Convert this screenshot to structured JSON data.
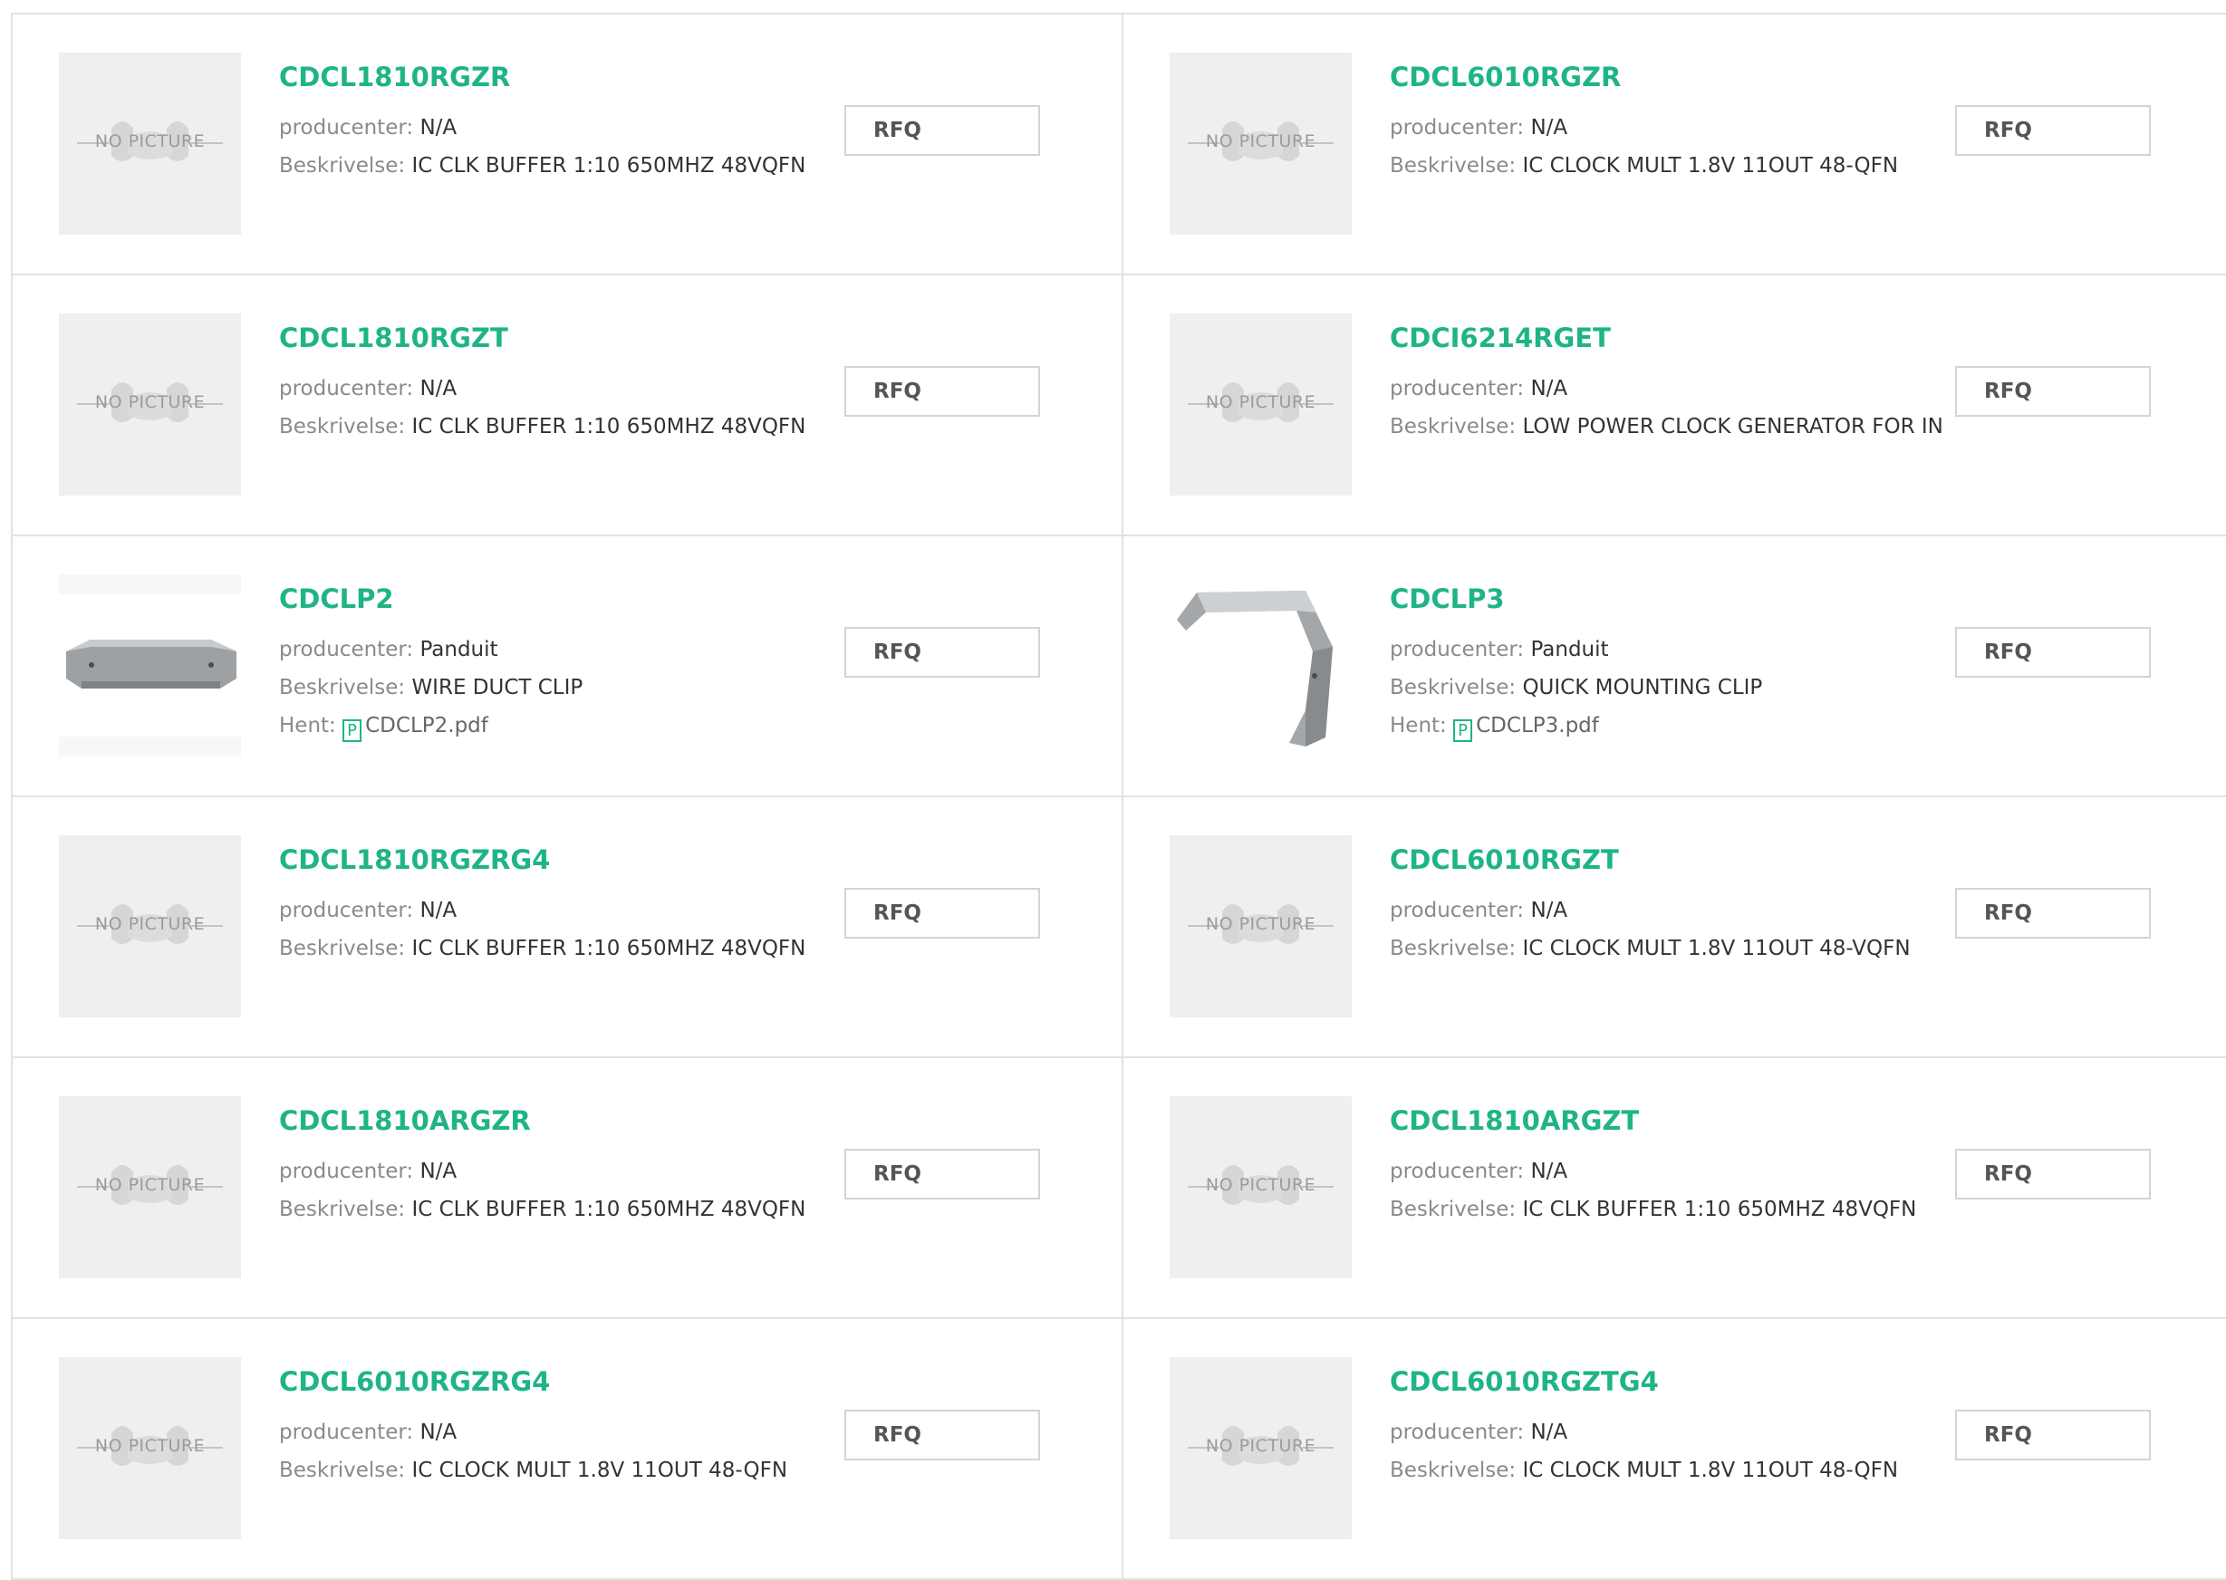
{
  "labels": {
    "producer": "producenter: ",
    "description": "Beskrivelse: ",
    "download": "Hent: ",
    "rfq": "RFQ",
    "no_picture": "NO PICTURE",
    "pdf_icon_letter": "P"
  },
  "products": [
    {
      "part": "CDCL1810RGZR",
      "producer": "N/A",
      "description": "IC CLK BUFFER 1:10 650MHZ 48VQFN",
      "image": "no-picture"
    },
    {
      "part": "CDCL6010RGZR",
      "producer": "N/A",
      "description": "IC CLOCK MULT 1.8V 11OUT 48-QFN",
      "image": "no-picture"
    },
    {
      "part": "CDCL1810RGZT",
      "producer": "N/A",
      "description": "IC CLK BUFFER 1:10 650MHZ 48VQFN",
      "image": "no-picture"
    },
    {
      "part": "CDCI6214RGET",
      "producer": "N/A",
      "description": "LOW POWER CLOCK GENERATOR FOR IN",
      "image": "no-picture"
    },
    {
      "part": "CDCLP2",
      "producer": "Panduit",
      "description": "WIRE DUCT CLIP",
      "image": "wire-duct-clip-photo",
      "datasheet": "CDCLP2.pdf"
    },
    {
      "part": "CDCLP3",
      "producer": "Panduit",
      "description": "QUICK MOUNTING CLIP",
      "image": "quick-mounting-clip-photo",
      "datasheet": "CDCLP3.pdf"
    },
    {
      "part": "CDCL1810RGZRG4",
      "producer": "N/A",
      "description": "IC CLK BUFFER 1:10 650MHZ 48VQFN",
      "image": "no-picture"
    },
    {
      "part": "CDCL6010RGZT",
      "producer": "N/A",
      "description": "IC CLOCK MULT 1.8V 11OUT 48-VQFN",
      "image": "no-picture"
    },
    {
      "part": "CDCL1810ARGZR",
      "producer": "N/A",
      "description": "IC CLK BUFFER 1:10 650MHZ 48VQFN",
      "image": "no-picture"
    },
    {
      "part": "CDCL1810ARGZT",
      "producer": "N/A",
      "description": "IC CLK BUFFER 1:10 650MHZ 48VQFN",
      "image": "no-picture"
    },
    {
      "part": "CDCL6010RGZRG4",
      "producer": "N/A",
      "description": "IC CLOCK MULT 1.8V 11OUT 48-QFN",
      "image": "no-picture"
    },
    {
      "part": "CDCL6010RGZTG4",
      "producer": "N/A",
      "description": "IC CLOCK MULT 1.8V 11OUT 48-QFN",
      "image": "no-picture"
    }
  ],
  "colors": {
    "part_link": "#1fb487",
    "label_text": "#8a8a8a",
    "value_text": "#333333",
    "border": "#e2e2e2",
    "placeholder_bg": "#efefef"
  }
}
